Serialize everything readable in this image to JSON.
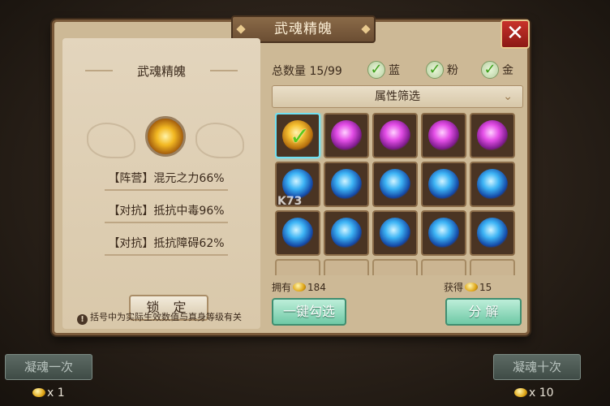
{
  "dialog": {
    "title": "武魂精魄",
    "close_icon": "close-icon"
  },
  "left": {
    "essence_title": "武魂精魄",
    "attributes": [
      "【阵营】混元之力66%",
      "【对抗】抵抗中毒96%",
      "【对抗】抵抗障碍62%"
    ],
    "lock_label": "锁 定",
    "note": "括号中为实际生效数值与真身等级有关"
  },
  "right": {
    "total_label": "总数量 15/99",
    "filters": [
      {
        "label": "蓝",
        "checked": true
      },
      {
        "label": "粉",
        "checked": true
      },
      {
        "label": "金",
        "checked": true
      }
    ],
    "filter_bar_label": "属性筛选",
    "grid": [
      {
        "color": "gold",
        "selected": true
      },
      {
        "color": "pink"
      },
      {
        "color": "pink"
      },
      {
        "color": "pink"
      },
      {
        "color": "pink"
      },
      {
        "color": "blue"
      },
      {
        "color": "blue"
      },
      {
        "color": "blue"
      },
      {
        "color": "blue"
      },
      {
        "color": "blue"
      },
      {
        "color": "blue"
      },
      {
        "color": "blue"
      },
      {
        "color": "blue"
      },
      {
        "color": "blue"
      },
      {
        "color": "blue"
      },
      {
        "color": "empty"
      },
      {
        "color": "empty"
      },
      {
        "color": "empty"
      },
      {
        "color": "empty"
      },
      {
        "color": "empty"
      }
    ],
    "own_label": "拥有",
    "own_value": "184",
    "gain_label": "获得",
    "gain_value": "15",
    "select_all_label": "一键勾选",
    "decompose_label": "分 解"
  },
  "bottom": {
    "once_label": "凝魂一次",
    "once_cost": "x 1",
    "ten_label": "凝魂十次",
    "ten_cost": "x 10"
  },
  "watermark": "K73"
}
